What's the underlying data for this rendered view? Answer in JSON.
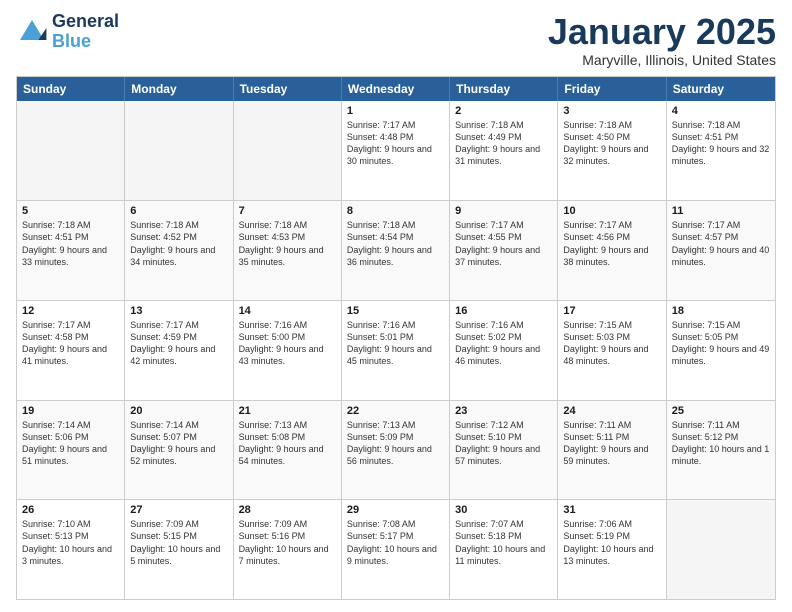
{
  "header": {
    "logo_line1": "General",
    "logo_line2": "Blue",
    "month_title": "January 2025",
    "location": "Maryville, Illinois, United States"
  },
  "days_of_week": [
    "Sunday",
    "Monday",
    "Tuesday",
    "Wednesday",
    "Thursday",
    "Friday",
    "Saturday"
  ],
  "weeks": [
    [
      {
        "day": "",
        "empty": true
      },
      {
        "day": "",
        "empty": true
      },
      {
        "day": "",
        "empty": true
      },
      {
        "day": "1",
        "sunrise": "7:17 AM",
        "sunset": "4:48 PM",
        "daylight": "9 hours and 30 minutes."
      },
      {
        "day": "2",
        "sunrise": "7:18 AM",
        "sunset": "4:49 PM",
        "daylight": "9 hours and 31 minutes."
      },
      {
        "day": "3",
        "sunrise": "7:18 AM",
        "sunset": "4:50 PM",
        "daylight": "9 hours and 32 minutes."
      },
      {
        "day": "4",
        "sunrise": "7:18 AM",
        "sunset": "4:51 PM",
        "daylight": "9 hours and 32 minutes."
      }
    ],
    [
      {
        "day": "5",
        "sunrise": "7:18 AM",
        "sunset": "4:51 PM",
        "daylight": "9 hours and 33 minutes."
      },
      {
        "day": "6",
        "sunrise": "7:18 AM",
        "sunset": "4:52 PM",
        "daylight": "9 hours and 34 minutes."
      },
      {
        "day": "7",
        "sunrise": "7:18 AM",
        "sunset": "4:53 PM",
        "daylight": "9 hours and 35 minutes."
      },
      {
        "day": "8",
        "sunrise": "7:18 AM",
        "sunset": "4:54 PM",
        "daylight": "9 hours and 36 minutes."
      },
      {
        "day": "9",
        "sunrise": "7:17 AM",
        "sunset": "4:55 PM",
        "daylight": "9 hours and 37 minutes."
      },
      {
        "day": "10",
        "sunrise": "7:17 AM",
        "sunset": "4:56 PM",
        "daylight": "9 hours and 38 minutes."
      },
      {
        "day": "11",
        "sunrise": "7:17 AM",
        "sunset": "4:57 PM",
        "daylight": "9 hours and 40 minutes."
      }
    ],
    [
      {
        "day": "12",
        "sunrise": "7:17 AM",
        "sunset": "4:58 PM",
        "daylight": "9 hours and 41 minutes."
      },
      {
        "day": "13",
        "sunrise": "7:17 AM",
        "sunset": "4:59 PM",
        "daylight": "9 hours and 42 minutes."
      },
      {
        "day": "14",
        "sunrise": "7:16 AM",
        "sunset": "5:00 PM",
        "daylight": "9 hours and 43 minutes."
      },
      {
        "day": "15",
        "sunrise": "7:16 AM",
        "sunset": "5:01 PM",
        "daylight": "9 hours and 45 minutes."
      },
      {
        "day": "16",
        "sunrise": "7:16 AM",
        "sunset": "5:02 PM",
        "daylight": "9 hours and 46 minutes."
      },
      {
        "day": "17",
        "sunrise": "7:15 AM",
        "sunset": "5:03 PM",
        "daylight": "9 hours and 48 minutes."
      },
      {
        "day": "18",
        "sunrise": "7:15 AM",
        "sunset": "5:05 PM",
        "daylight": "9 hours and 49 minutes."
      }
    ],
    [
      {
        "day": "19",
        "sunrise": "7:14 AM",
        "sunset": "5:06 PM",
        "daylight": "9 hours and 51 minutes."
      },
      {
        "day": "20",
        "sunrise": "7:14 AM",
        "sunset": "5:07 PM",
        "daylight": "9 hours and 52 minutes."
      },
      {
        "day": "21",
        "sunrise": "7:13 AM",
        "sunset": "5:08 PM",
        "daylight": "9 hours and 54 minutes."
      },
      {
        "day": "22",
        "sunrise": "7:13 AM",
        "sunset": "5:09 PM",
        "daylight": "9 hours and 56 minutes."
      },
      {
        "day": "23",
        "sunrise": "7:12 AM",
        "sunset": "5:10 PM",
        "daylight": "9 hours and 57 minutes."
      },
      {
        "day": "24",
        "sunrise": "7:11 AM",
        "sunset": "5:11 PM",
        "daylight": "9 hours and 59 minutes."
      },
      {
        "day": "25",
        "sunrise": "7:11 AM",
        "sunset": "5:12 PM",
        "daylight": "10 hours and 1 minute."
      }
    ],
    [
      {
        "day": "26",
        "sunrise": "7:10 AM",
        "sunset": "5:13 PM",
        "daylight": "10 hours and 3 minutes."
      },
      {
        "day": "27",
        "sunrise": "7:09 AM",
        "sunset": "5:15 PM",
        "daylight": "10 hours and 5 minutes."
      },
      {
        "day": "28",
        "sunrise": "7:09 AM",
        "sunset": "5:16 PM",
        "daylight": "10 hours and 7 minutes."
      },
      {
        "day": "29",
        "sunrise": "7:08 AM",
        "sunset": "5:17 PM",
        "daylight": "10 hours and 9 minutes."
      },
      {
        "day": "30",
        "sunrise": "7:07 AM",
        "sunset": "5:18 PM",
        "daylight": "10 hours and 11 minutes."
      },
      {
        "day": "31",
        "sunrise": "7:06 AM",
        "sunset": "5:19 PM",
        "daylight": "10 hours and 13 minutes."
      },
      {
        "day": "",
        "empty": true
      }
    ]
  ]
}
